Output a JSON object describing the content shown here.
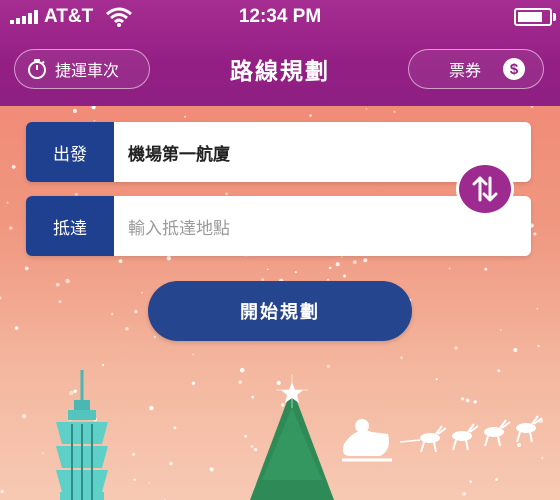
{
  "status": {
    "carrier": "AT&T",
    "time": "12:34 PM",
    "battery_level": 0.85
  },
  "header": {
    "title": "路線規劃",
    "left_button": {
      "label": "捷運車次",
      "icon": "stopwatch-icon"
    },
    "right_button": {
      "label": "票券",
      "icon": "dollar-coin-icon",
      "icon_text": "$"
    }
  },
  "form": {
    "from": {
      "label": "出發",
      "value": "機場第一航廈"
    },
    "to": {
      "label": "抵達",
      "placeholder": "輸入抵達地點"
    },
    "swap_icon": "swap-arrows-icon"
  },
  "start_button": {
    "label": "開始規劃"
  },
  "colors": {
    "header": "#941f84",
    "accent_purple": "#9c2a8f",
    "button_blue": "#25458f",
    "background_top": "#f0816f",
    "background_bottom": "#f7c9b3"
  },
  "scenery": [
    "taipei-101-icon",
    "christmas-tree-icon",
    "santa-sleigh-icon"
  ]
}
